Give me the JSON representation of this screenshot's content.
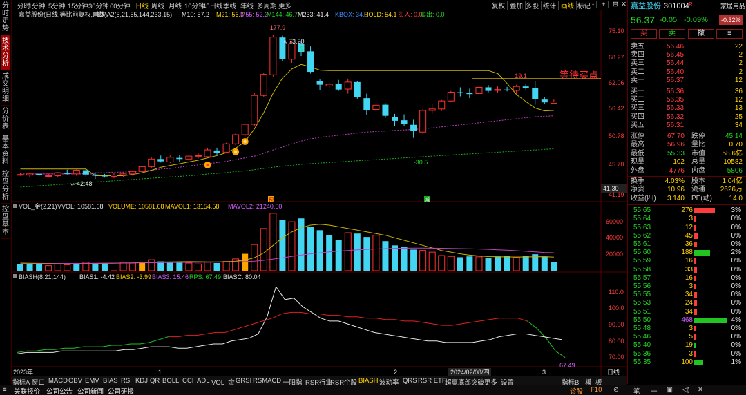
{
  "left_tabs": [
    "分时走势",
    "技术分析",
    "成交明细",
    "分价表",
    "基本资料",
    "控盘分析",
    "控盘基本"
  ],
  "period_tabs": [
    "分时",
    "1分钟",
    "5分钟",
    "15分钟",
    "30分钟",
    "60分钟",
    "日线",
    "周线",
    "月线",
    "10分钟",
    "45日线",
    "季线",
    "年线",
    "多周期",
    "更多"
  ],
  "toolbar": [
    "复权",
    "叠加",
    "多股",
    "统计",
    "画线",
    "标记",
    "-",
    "+"
  ],
  "window_icons": [
    "⊟",
    "✕"
  ],
  "top_right_label": "家居用品",
  "stock": {
    "name": "嘉益股份",
    "code": "301004",
    "badge": "R",
    "price": "56.37",
    "change": "-0.05",
    "pct": "-0.09%",
    "sector_pct": "-0.32%"
  },
  "action_buttons": [
    "买",
    "卖",
    "撤",
    "≡"
  ],
  "main_legend": {
    "name": "嘉益股份(日线,等比前复权,对数)",
    "ema": "EMA2(5,21,55,144,233,15)",
    "m10": "M10: 57.2",
    "m21": "M21: 56.7",
    "m55": "M55: 52.3",
    "m144": "M144: 46.7",
    "m233": "M233: 41.4",
    "kbox": "KBOX: 34.0",
    "hold": "HOLD: 54.1",
    "buy": "买入: 0.0",
    "sell": "卖出: 0.0"
  },
  "price_axis": [
    "75.10",
    "68.27",
    "62.06",
    "56.42",
    "50.78",
    "45.70",
    "41.30",
    "41.19"
  ],
  "annotations": {
    "high": "177.9",
    "peak": "73.20",
    "peak_arrow": "↖",
    "marker19": "19.1",
    "wait_buy": "等待买点",
    "low": "-30.5",
    "left_low": "42.48",
    "left_low_arrow": "←",
    "up_arrow": "⇧",
    "mk_yu": "预",
    "mk_zeng": "减"
  },
  "vol_legend": {
    "name": "VOL_金(2,21)",
    "vvol": "VVOL: 10581.68",
    "volume": "VOLUME: 10581.68",
    "mavol1": "MAVOL1: 13154.58",
    "mavol2": "MAVOL2: 21240.60"
  },
  "vol_axis": [
    "60000",
    "40000",
    "20000"
  ],
  "bias_legend": {
    "name": "BIASH(8,21,144)",
    "b1": "BIAS1: -4.42",
    "b2": "BIAS2: -3.99",
    "b3": "BIAS3: 15.46",
    "rps": "RPS: 67.49",
    "biasc": "BIASC: 80.04"
  },
  "bias_axis": [
    "110.0",
    "100.0",
    "90.00",
    "80.00",
    "70.00"
  ],
  "bias_last": "67.49",
  "date_axis": {
    "year": "2023年",
    "m1": "1",
    "m2": "2",
    "sel": "2024/02/08/四",
    "m3": "3",
    "right": "日线"
  },
  "bottom_tabs": [
    "指标A",
    "窗口",
    "MACD",
    "OBV",
    "EMV",
    "BIAS",
    "RSI",
    "KDJ",
    "QR",
    "BOLL",
    "CCI",
    "ADL",
    "VOL_金",
    "GRSI",
    "RSMACD",
    "一阳指",
    "RSR行业",
    "RSR个股",
    "BIASH",
    "波动率",
    "QRS",
    "RSR ETF",
    "超赢底部突破",
    "更多",
    "设置",
    "指标B",
    "模",
    "板"
  ],
  "orderbook_sell": [
    {
      "label": "卖五",
      "price": "56.46",
      "vol": "22"
    },
    {
      "label": "卖四",
      "price": "56.45",
      "vol": "2"
    },
    {
      "label": "卖三",
      "price": "56.44",
      "vol": "2"
    },
    {
      "label": "卖二",
      "price": "56.40",
      "vol": "2"
    },
    {
      "label": "卖一",
      "price": "56.37",
      "vol": "12"
    }
  ],
  "orderbook_buy": [
    {
      "label": "买一",
      "price": "56.36",
      "vol": "36"
    },
    {
      "label": "买二",
      "price": "56.35",
      "vol": "12"
    },
    {
      "label": "买三",
      "price": "56.33",
      "vol": "13"
    },
    {
      "label": "买四",
      "price": "56.32",
      "vol": "25"
    },
    {
      "label": "买五",
      "price": "56.31",
      "vol": "34"
    }
  ],
  "stats": [
    [
      {
        "l": "涨停",
        "v": "67.70"
      },
      {
        "l": "跌停",
        "v": "45.14"
      }
    ],
    [
      {
        "l": "最高",
        "v": "56.96"
      },
      {
        "l": "量比",
        "v": "0.70"
      }
    ],
    [
      {
        "l": "最低",
        "v": "55.33"
      },
      {
        "l": "市值",
        "v": "58.6亿"
      }
    ],
    [
      {
        "l": "现量",
        "v": "102"
      },
      {
        "l": "总量",
        "v": "10582"
      }
    ],
    [
      {
        "l": "外盘",
        "v": "4776"
      },
      {
        "l": "内盘",
        "v": "5806"
      }
    ],
    [
      {
        "l": "换手",
        "v": "4.03%"
      },
      {
        "l": "股本",
        "v": "1.04亿"
      }
    ],
    [
      {
        "l": "净资",
        "v": "10.96"
      },
      {
        "l": "流通",
        "v": "2626万"
      }
    ],
    [
      {
        "l": "收益(四)",
        "v": "3.140"
      },
      {
        "l": "PE(动)",
        "v": "14.0"
      }
    ]
  ],
  "price_dist": [
    {
      "p": "55.65",
      "v": "276",
      "pct": "3%",
      "bar": 0.6,
      "s": "buy"
    },
    {
      "p": "55.64",
      "v": "3",
      "pct": "0%",
      "bar": 0.02,
      "s": "buy"
    },
    {
      "p": "55.63",
      "v": "12",
      "pct": "0%",
      "bar": 0.05,
      "s": "buy"
    },
    {
      "p": "55.62",
      "v": "45",
      "pct": "0%",
      "bar": 0.1,
      "s": "buy"
    },
    {
      "p": "55.61",
      "v": "36",
      "pct": "0%",
      "bar": 0.08,
      "s": "buy"
    },
    {
      "p": "55.60",
      "v": "188",
      "pct": "2%",
      "bar": 0.45,
      "s": "sell"
    },
    {
      "p": "55.59",
      "v": "16",
      "pct": "0%",
      "bar": 0.05,
      "s": "buy"
    },
    {
      "p": "55.58",
      "v": "33",
      "pct": "0%",
      "bar": 0.08,
      "s": "buy"
    },
    {
      "p": "55.57",
      "v": "16",
      "pct": "0%",
      "bar": 0.05,
      "s": "buy"
    },
    {
      "p": "55.56",
      "v": "3",
      "pct": "0%",
      "bar": 0.02,
      "s": "buy"
    },
    {
      "p": "55.55",
      "v": "34",
      "pct": "0%",
      "bar": 0.08,
      "s": "buy"
    },
    {
      "p": "55.53",
      "v": "24",
      "pct": "0%",
      "bar": 0.07,
      "s": "buy"
    },
    {
      "p": "55.51",
      "v": "34",
      "pct": "0%",
      "bar": 0.08,
      "s": "buy"
    },
    {
      "p": "55.50",
      "v": "468",
      "pct": "4%",
      "bar": 0.95,
      "s": "sell"
    },
    {
      "p": "55.48",
      "v": "3",
      "pct": "0%",
      "bar": 0.02,
      "s": "buy"
    },
    {
      "p": "55.46",
      "v": "5",
      "pct": "0%",
      "bar": 0.03,
      "s": "buy"
    },
    {
      "p": "55.40",
      "v": "19",
      "pct": "0%",
      "bar": 0.05,
      "s": "sell"
    },
    {
      "p": "55.36",
      "v": "3",
      "pct": "0%",
      "bar": 0.02,
      "s": "buy"
    },
    {
      "p": "55.35",
      "v": "100",
      "pct": "1%",
      "bar": 0.25,
      "s": "sell"
    }
  ],
  "status_items": [
    "关联报价",
    "公司公告",
    "公司新闻",
    "公司研报"
  ],
  "status_right": [
    "诊股",
    "F10",
    "⊘",
    "笔",
    "一",
    "▣",
    "◁)",
    "✕"
  ],
  "chart_data": {
    "type": "candlestick+line",
    "price_scale": "log",
    "ylim": [
      41.19,
      77.0
    ],
    "candles": [
      [
        43.3,
        43.6,
        43.1,
        43.3
      ],
      [
        43.2,
        43.5,
        42.9,
        43.4
      ],
      [
        43.4,
        43.6,
        43.0,
        43.2
      ],
      [
        43.1,
        43.4,
        42.8,
        43.1
      ],
      [
        43.1,
        43.7,
        42.9,
        43.6
      ],
      [
        43.6,
        44.1,
        43.3,
        43.4
      ],
      [
        43.4,
        44.2,
        43.1,
        44.0
      ],
      [
        44.0,
        44.3,
        43.0,
        43.3
      ],
      [
        43.3,
        43.5,
        42.6,
        43.1
      ],
      [
        43.1,
        43.4,
        42.8,
        43.0
      ],
      [
        43.0,
        43.5,
        42.7,
        43.2
      ],
      [
        43.2,
        43.6,
        42.9,
        43.4
      ],
      [
        43.4,
        44.0,
        43.1,
        43.8
      ],
      [
        43.8,
        44.8,
        43.6,
        44.6
      ],
      [
        44.6,
        46.3,
        44.4,
        45.9
      ],
      [
        45.9,
        46.5,
        45.3,
        45.5
      ],
      [
        45.4,
        46.5,
        45.2,
        46.2
      ],
      [
        46.1,
        46.6,
        45.4,
        45.9
      ],
      [
        45.9,
        46.6,
        45.6,
        46.4
      ],
      [
        46.4,
        46.9,
        46.0,
        46.5
      ],
      [
        46.3,
        47.8,
        46.2,
        47.5
      ],
      [
        47.4,
        47.9,
        46.6,
        47.0
      ],
      [
        47.1,
        48.8,
        47.0,
        48.6
      ],
      [
        48.6,
        50.7,
        48.3,
        50.3
      ],
      [
        50.3,
        52.5,
        49.8,
        52.3
      ],
      [
        52.3,
        58.8,
        52.0,
        58.3
      ],
      [
        58.3,
        63.5,
        57.9,
        63.1
      ],
      [
        63.0,
        73.2,
        62.6,
        72.6
      ],
      [
        72.5,
        73.0,
        66.3,
        66.8
      ],
      [
        66.8,
        71.6,
        65.9,
        70.8
      ],
      [
        70.7,
        71.5,
        67.6,
        68.6
      ],
      [
        68.8,
        70.1,
        63.3,
        63.7
      ],
      [
        61.5,
        61.9,
        59.4,
        60.7
      ],
      [
        60.4,
        61.2,
        59.9,
        60.8
      ],
      [
        60.8,
        61.8,
        59.3,
        59.6
      ],
      [
        59.7,
        62.1,
        58.7,
        61.3
      ],
      [
        61.3,
        61.6,
        57.6,
        57.9
      ],
      [
        57.7,
        58.7,
        54.1,
        55.2
      ],
      [
        55.3,
        56.8,
        55.0,
        56.2
      ],
      [
        56.3,
        56.6,
        53.6,
        54.0
      ],
      [
        53.8,
        54.4,
        51.9,
        53.0
      ],
      [
        53.1,
        54.3,
        52.0,
        52.3
      ],
      [
        52.2,
        53.2,
        49.7,
        51.0
      ],
      [
        50.8,
        55.4,
        50.5,
        55.1
      ],
      [
        55.1,
        56.5,
        54.4,
        55.4
      ],
      [
        55.4,
        57.3,
        55.0,
        57.1
      ],
      [
        57.1,
        59.3,
        56.8,
        59.0
      ],
      [
        59.0,
        60.1,
        58.1,
        58.8
      ],
      [
        58.9,
        59.8,
        57.7,
        58.6
      ],
      [
        58.7,
        60.3,
        58.4,
        60.1
      ],
      [
        60.1,
        60.6,
        59.0,
        59.3
      ],
      [
        59.4,
        60.3,
        58.9,
        59.6
      ],
      [
        59.6,
        60.2,
        59.2,
        59.5
      ],
      [
        59.4,
        60.7,
        58.6,
        60.3
      ],
      [
        60.3,
        60.9,
        59.6,
        60.0
      ],
      [
        60.0,
        61.6,
        56.3,
        57.5
      ],
      [
        57.4,
        57.9,
        56.4,
        56.8
      ],
      [
        56.6,
        57.4,
        56.4,
        56.9
      ]
    ],
    "ma_yellow": [
      44.2,
      44.2,
      44.2,
      44.2,
      44.2,
      44.2,
      44.2,
      44.2,
      43.1,
      43.1,
      43.1,
      43.1,
      43.3,
      43.6,
      44.0,
      44.5,
      44.8,
      45.1,
      45.4,
      45.7,
      46.1,
      46.5,
      47.0,
      47.8,
      49.0,
      51.4,
      54.6,
      58.8,
      62.2,
      64.4,
      65.5,
      64.9,
      64.1,
      64.0,
      64.0,
      64.0,
      64.0,
      64.0,
      64.0,
      64.0,
      64.0,
      64.0,
      64.0,
      64.0,
      64.0,
      64.0,
      64.0,
      64.0,
      64.0,
      64.0,
      64.0,
      63.3,
      61.0,
      58.5,
      57.0,
      55.6,
      55.0,
      55.1
    ],
    "ma_magenta": [
      43.4,
      43.4,
      43.4,
      43.4,
      43.4,
      43.4,
      43.5,
      43.5,
      43.6,
      43.6,
      43.7,
      43.7,
      43.8,
      43.9,
      44.0,
      44.2,
      44.3,
      44.5,
      44.7,
      44.9,
      45.1,
      45.3,
      45.5,
      45.8,
      46.1,
      46.4,
      46.9,
      47.5,
      48.0,
      48.6,
      49.1,
      49.5,
      49.8,
      50.0,
      50.2,
      50.4,
      50.6,
      50.8,
      50.9,
      51.0,
      51.1,
      51.2,
      51.3,
      51.4,
      51.6,
      51.8,
      52.0,
      52.2,
      52.4,
      52.6,
      52.8,
      53.0,
      53.2,
      53.4,
      53.6,
      53.8,
      53.9,
      54.0
    ],
    "ma_green": [
      41.3,
      41.4,
      41.5,
      41.6,
      41.7,
      41.8,
      41.9,
      42.0,
      42.1,
      42.2,
      42.3,
      42.4,
      42.5,
      42.6,
      42.7,
      42.8,
      42.9,
      43.0,
      43.1,
      43.2,
      43.4,
      43.5,
      43.6,
      43.8,
      43.9,
      44.1,
      44.3,
      44.5,
      44.7,
      44.8,
      45.0,
      45.1,
      45.2,
      45.3,
      45.4,
      45.5,
      45.6,
      45.7,
      45.8,
      45.9,
      46.0,
      46.1,
      46.2,
      46.3,
      46.4,
      46.5,
      46.6,
      46.7,
      46.8,
      46.9,
      47.0,
      47.1,
      47.2,
      47.3,
      47.4,
      47.5,
      47.6,
      47.7
    ],
    "volume": [
      8000,
      8000,
      9000,
      6000,
      8000,
      7000,
      9000,
      10000,
      8000,
      9000,
      9000,
      10000,
      9000,
      10000,
      13000,
      11000,
      10000,
      9500,
      9000,
      8000,
      10000,
      9000,
      11000,
      14000,
      20000,
      31000,
      50000,
      68000,
      60000,
      58000,
      62000,
      52000,
      48000,
      42000,
      36000,
      45000,
      44000,
      40000,
      42000,
      35000,
      30000,
      28000,
      25000,
      24000,
      22000,
      18000,
      17000,
      16000,
      17000,
      16500,
      15000,
      17000,
      18000,
      16000,
      18000,
      19500,
      17000,
      10581
    ],
    "volume_color": [
      "c",
      "c",
      "c",
      "r",
      "r",
      "r",
      "c",
      "r",
      "c",
      "c",
      "r",
      "r",
      "r",
      "r",
      "r",
      "c",
      "c",
      "c",
      "r",
      "r",
      "r",
      "c",
      "r",
      "r",
      "r",
      "r",
      "r",
      "r",
      "c",
      "r",
      "c",
      "c",
      "c",
      "c",
      "c",
      "r",
      "c",
      "c",
      "r",
      "c",
      "c",
      "c",
      "c",
      "r",
      "r",
      "r",
      "r",
      "c",
      "c",
      "r",
      "c",
      "c",
      "c",
      "r",
      "c",
      "c",
      "c",
      "c"
    ],
    "volume_highlight": {
      "13": "#ffa500",
      "24": "#ffa500"
    },
    "mavol1": [
      9000,
      8800,
      8700,
      8600,
      8500,
      8400,
      8400,
      8500,
      8600,
      8700,
      8800,
      9000,
      9200,
      9500,
      10000,
      10300,
      10500,
      10600,
      10700,
      10600,
      10500,
      10400,
      10600,
      11200,
      12600,
      15500,
      21000,
      30000,
      39000,
      46000,
      51000,
      54000,
      55000,
      54000,
      52000,
      50000,
      48000,
      46000,
      44000,
      42000,
      39000,
      36000,
      33000,
      30000,
      27000,
      24000,
      22000,
      20000,
      18500,
      17500,
      16800,
      16500,
      16400,
      16300,
      16400,
      16600,
      16700,
      16200
    ],
    "mavol2": [
      8000,
      8100,
      8200,
      8300,
      8400,
      8500,
      8600,
      8700,
      8800,
      8900,
      9000,
      9100,
      9200,
      9300,
      9400,
      9500,
      9600,
      9700,
      9800,
      9900,
      10000,
      10100,
      10300,
      10500,
      10800,
      11300,
      12300,
      13800,
      15400,
      17000,
      18600,
      20000,
      21200,
      22300,
      23200,
      24000,
      24700,
      25300,
      25800,
      26200,
      26500,
      26700,
      26800,
      26800,
      26700,
      26600,
      26400,
      26200,
      26000,
      25700,
      25300,
      24800,
      24300,
      23700,
      23000,
      22300,
      21600,
      21240
    ]
  },
  "bias_series": {
    "red": [
      71,
      72,
      72,
      73,
      73,
      74,
      74,
      75,
      75,
      75,
      76,
      76,
      77,
      77,
      78,
      80,
      82,
      82,
      83,
      83,
      84,
      85,
      85,
      87,
      89,
      91,
      93,
      95,
      98,
      99,
      99,
      98,
      98,
      97,
      97,
      96,
      96,
      95,
      95,
      94,
      94,
      93,
      93,
      92,
      91,
      90,
      90,
      91,
      92,
      93,
      94,
      95,
      95,
      95,
      93,
      88,
      81,
      72,
      67.49
    ],
    "white": [
      70,
      71,
      71,
      71,
      71,
      72,
      72,
      72,
      72,
      72,
      72,
      72,
      73,
      73,
      74,
      75,
      75,
      75,
      74,
      74,
      75,
      76,
      77,
      77,
      79,
      80,
      81,
      84,
      96,
      117,
      108,
      109,
      103,
      99,
      95,
      93,
      93,
      91,
      89,
      87,
      85,
      84,
      83,
      82,
      81,
      80,
      79,
      79,
      78,
      78,
      78,
      78,
      79,
      80,
      82,
      83,
      84,
      84,
      83,
      82,
      81,
      80
    ]
  }
}
